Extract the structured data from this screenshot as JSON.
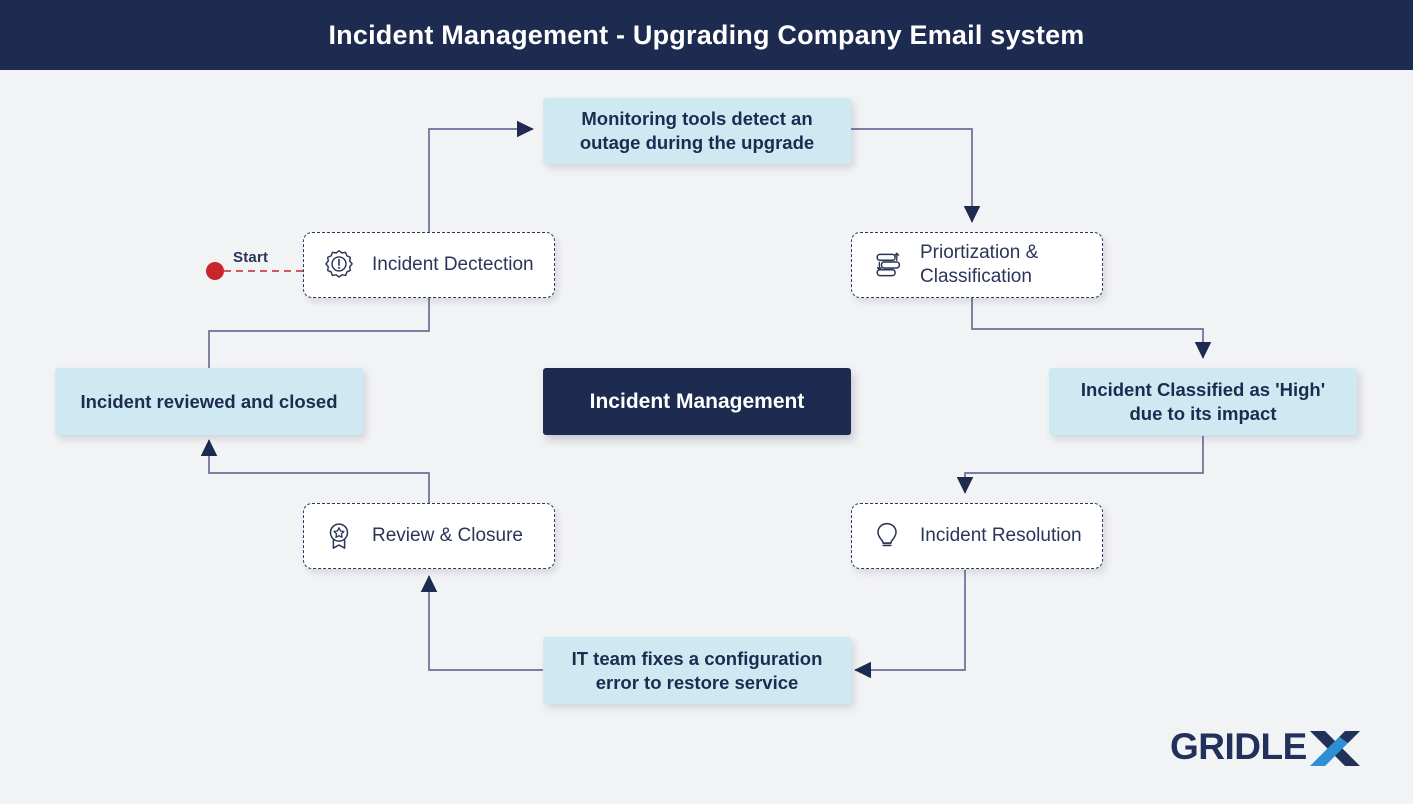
{
  "header": {
    "title": "Incident Management - Upgrading Company Email system"
  },
  "start": {
    "label": "Start",
    "dot_color": "#c9252d"
  },
  "colors": {
    "header_bg": "#1d2b50",
    "canvas_bg": "#f2f3f5",
    "accent_blue": "#cfe9f2",
    "navy": "#1d2b50",
    "line": "#6b6f99",
    "start_red": "#c9252d",
    "logo_blue": "#2f8fd4"
  },
  "nodes": {
    "monitoring": {
      "label": "Monitoring tools detect an outage during the upgrade",
      "type": "event"
    },
    "detection": {
      "label": "Incident Dectection",
      "icon": "badge-alert-icon",
      "type": "stage"
    },
    "prioritization": {
      "label": "Priortization & Classification",
      "icon": "sort-list-icon",
      "type": "stage"
    },
    "classified": {
      "label": "Incident Classified as 'High' due to its impact",
      "type": "event"
    },
    "center": {
      "label": "Incident Management",
      "type": "title"
    },
    "reviewed_closed": {
      "label": "Incident reviewed and closed",
      "type": "event"
    },
    "review_closure": {
      "label": "Review & Closure",
      "icon": "award-ribbon-icon",
      "type": "stage"
    },
    "resolution": {
      "label": "Incident Resolution",
      "icon": "lightbulb-icon",
      "type": "stage"
    },
    "it_fix": {
      "label": "IT team fixes a configuration error to restore service",
      "type": "event"
    }
  },
  "logo": {
    "text_main": "GRIDLE",
    "text_accent": "X",
    "name": "GRIDLEX"
  }
}
